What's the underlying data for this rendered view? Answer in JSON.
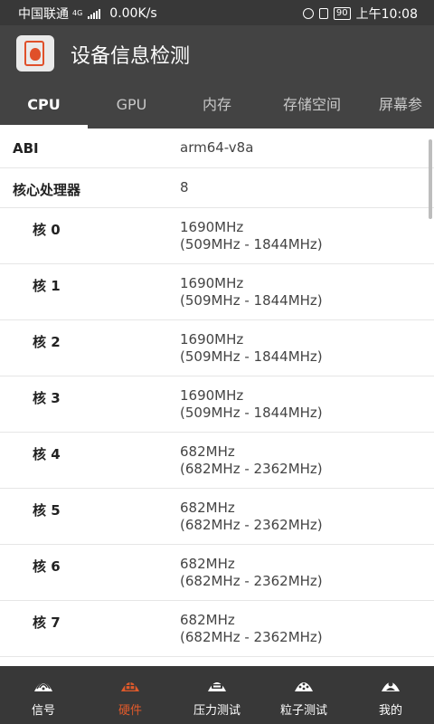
{
  "status_bar": {
    "carrier": "中国联通",
    "network": "4G",
    "speed": "0.00K/s",
    "battery": "90",
    "time": "上午10:08"
  },
  "app_bar": {
    "title": "设备信息检测"
  },
  "tabs": [
    {
      "label": "CPU",
      "active": true
    },
    {
      "label": "GPU",
      "active": false
    },
    {
      "label": "内存",
      "active": false
    },
    {
      "label": "存储空间",
      "active": false
    },
    {
      "label": "屏幕参",
      "active": false
    }
  ],
  "rows": [
    {
      "key": "ABI",
      "value1": "arm64-v8a",
      "value2": ""
    },
    {
      "key": "核心处理器",
      "value1": "8",
      "value2": ""
    },
    {
      "key": "核 0",
      "value1": "1690MHz",
      "value2": "(509MHz - 1844MHz)"
    },
    {
      "key": "核 1",
      "value1": "1690MHz",
      "value2": "(509MHz - 1844MHz)"
    },
    {
      "key": "核 2",
      "value1": "1690MHz",
      "value2": "(509MHz - 1844MHz)"
    },
    {
      "key": "核 3",
      "value1": "1690MHz",
      "value2": "(509MHz - 1844MHz)"
    },
    {
      "key": "核 4",
      "value1": "682MHz",
      "value2": "(682MHz - 2362MHz)"
    },
    {
      "key": "核 5",
      "value1": "682MHz",
      "value2": "(682MHz - 2362MHz)"
    },
    {
      "key": "核 6",
      "value1": "682MHz",
      "value2": "(682MHz - 2362MHz)"
    },
    {
      "key": "核 7",
      "value1": "682MHz",
      "value2": "(682MHz - 2362MHz)"
    }
  ],
  "bottom_nav": [
    {
      "label": "信号",
      "icon": "signal-icon",
      "active": false
    },
    {
      "label": "硬件",
      "icon": "hardware-icon",
      "active": true
    },
    {
      "label": "压力测试",
      "icon": "stress-test-icon",
      "active": false
    },
    {
      "label": "粒子测试",
      "icon": "particle-test-icon",
      "active": false
    },
    {
      "label": "我的",
      "icon": "profile-icon",
      "active": false
    }
  ],
  "colors": {
    "bar_bg": "#434343",
    "status_bg": "#383838",
    "accent": "#e05a2b"
  }
}
